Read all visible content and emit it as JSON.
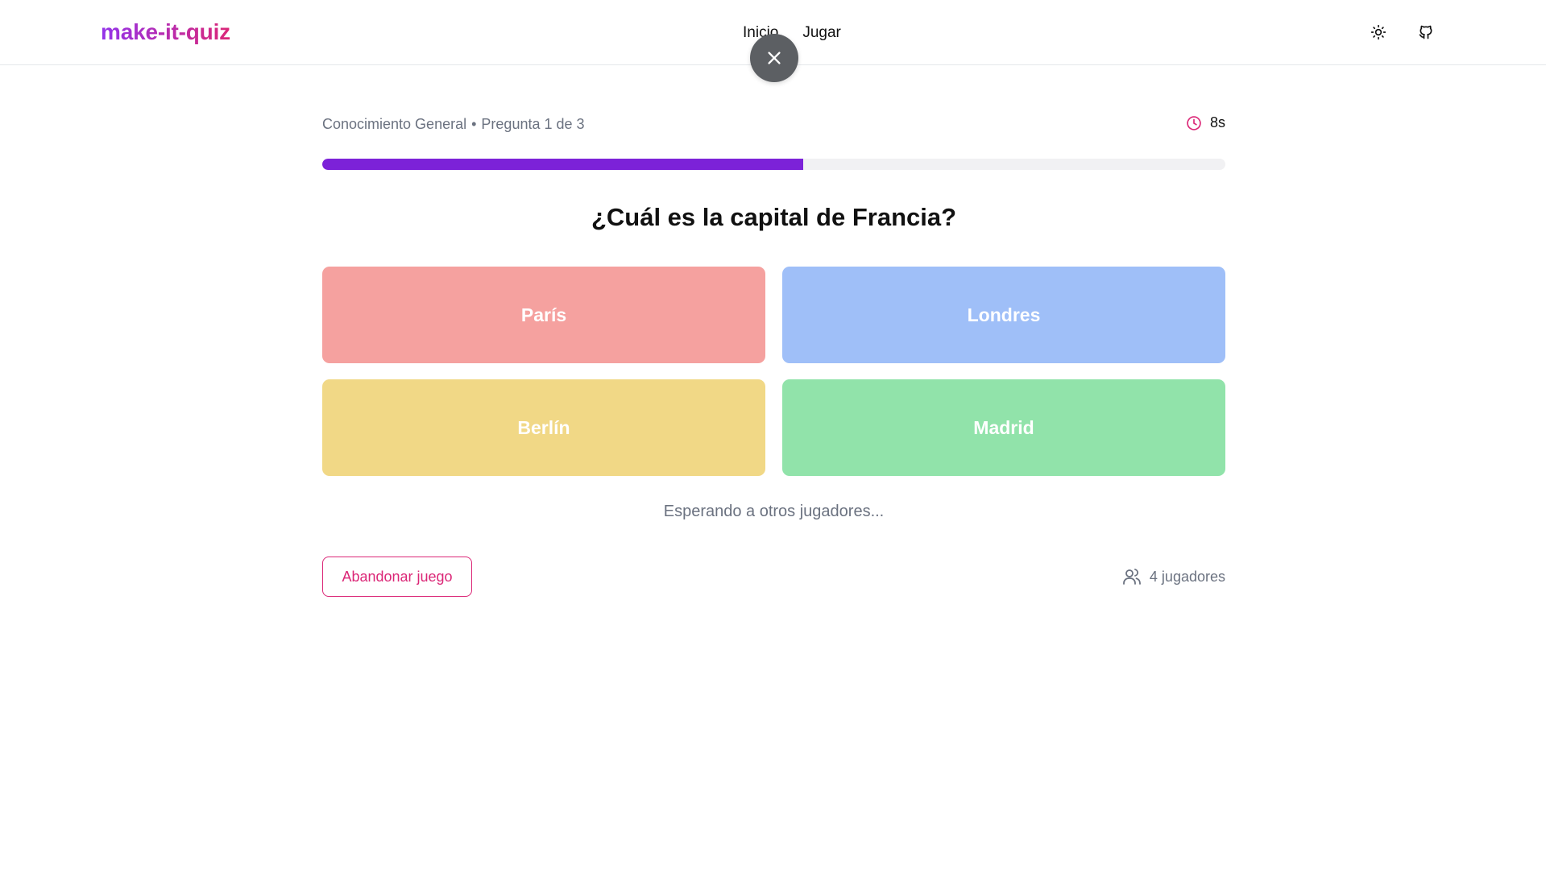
{
  "header": {
    "logo": "make-it-quiz",
    "nav": [
      {
        "label": "Inicio"
      },
      {
        "label": "Jugar"
      }
    ],
    "theme_icon": "sun-icon",
    "github_icon": "github-icon"
  },
  "overlay": {
    "close_icon": "close-icon"
  },
  "quiz": {
    "category": "Conocimiento General",
    "separator": "•",
    "question_counter": "Pregunta 1 de 3",
    "timer_icon": "clock-icon",
    "timer": "8s",
    "progress": 0.533,
    "question": "¿Cuál es la capital de Francia?",
    "answers": [
      {
        "label": "París",
        "color": "#f5a19f"
      },
      {
        "label": "Londres",
        "color": "#9fbff8"
      },
      {
        "label": "Berlín",
        "color": "#f1d886"
      },
      {
        "label": "Madrid",
        "color": "#91e3aa"
      }
    ],
    "waiting_text": "Esperando a otros jugadores...",
    "leave_button": "Abandonar juego",
    "players_icon": "users-icon",
    "players_count": "4 jugadores"
  },
  "colors": {
    "accent_purple": "#7c22d8",
    "accent_pink": "#db2777",
    "timer_icon": "#db2777"
  }
}
